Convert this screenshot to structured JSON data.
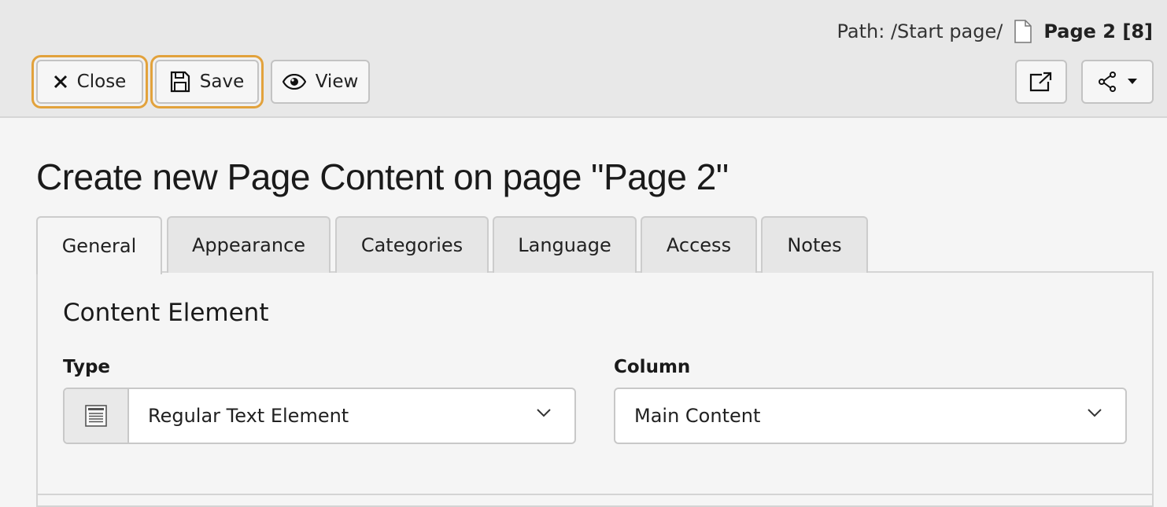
{
  "header": {
    "path_label": "Path: /Start page/",
    "page_title": "Page 2 [8]",
    "page_icon": "page-icon"
  },
  "toolbar": {
    "close_label": "Close",
    "save_label": "Save",
    "view_label": "View",
    "close_icon": "close-icon",
    "save_icon": "save-icon",
    "view_icon": "eye-icon",
    "newwin_icon": "external-link-icon",
    "share_icon": "share-icon"
  },
  "main": {
    "heading": "Create new Page Content on page \"Page 2\"",
    "tabs": [
      {
        "label": "General",
        "active": true
      },
      {
        "label": "Appearance",
        "active": false
      },
      {
        "label": "Categories",
        "active": false
      },
      {
        "label": "Language",
        "active": false
      },
      {
        "label": "Access",
        "active": false
      },
      {
        "label": "Notes",
        "active": false
      }
    ],
    "section_title": "Content Element",
    "type_field": {
      "label": "Type",
      "value": "Regular Text Element",
      "icon": "text-element-icon"
    },
    "column_field": {
      "label": "Column",
      "value": "Main Content"
    }
  },
  "colors": {
    "focus_ring": "#e2a23c",
    "topbar": "#e8e8e8"
  }
}
